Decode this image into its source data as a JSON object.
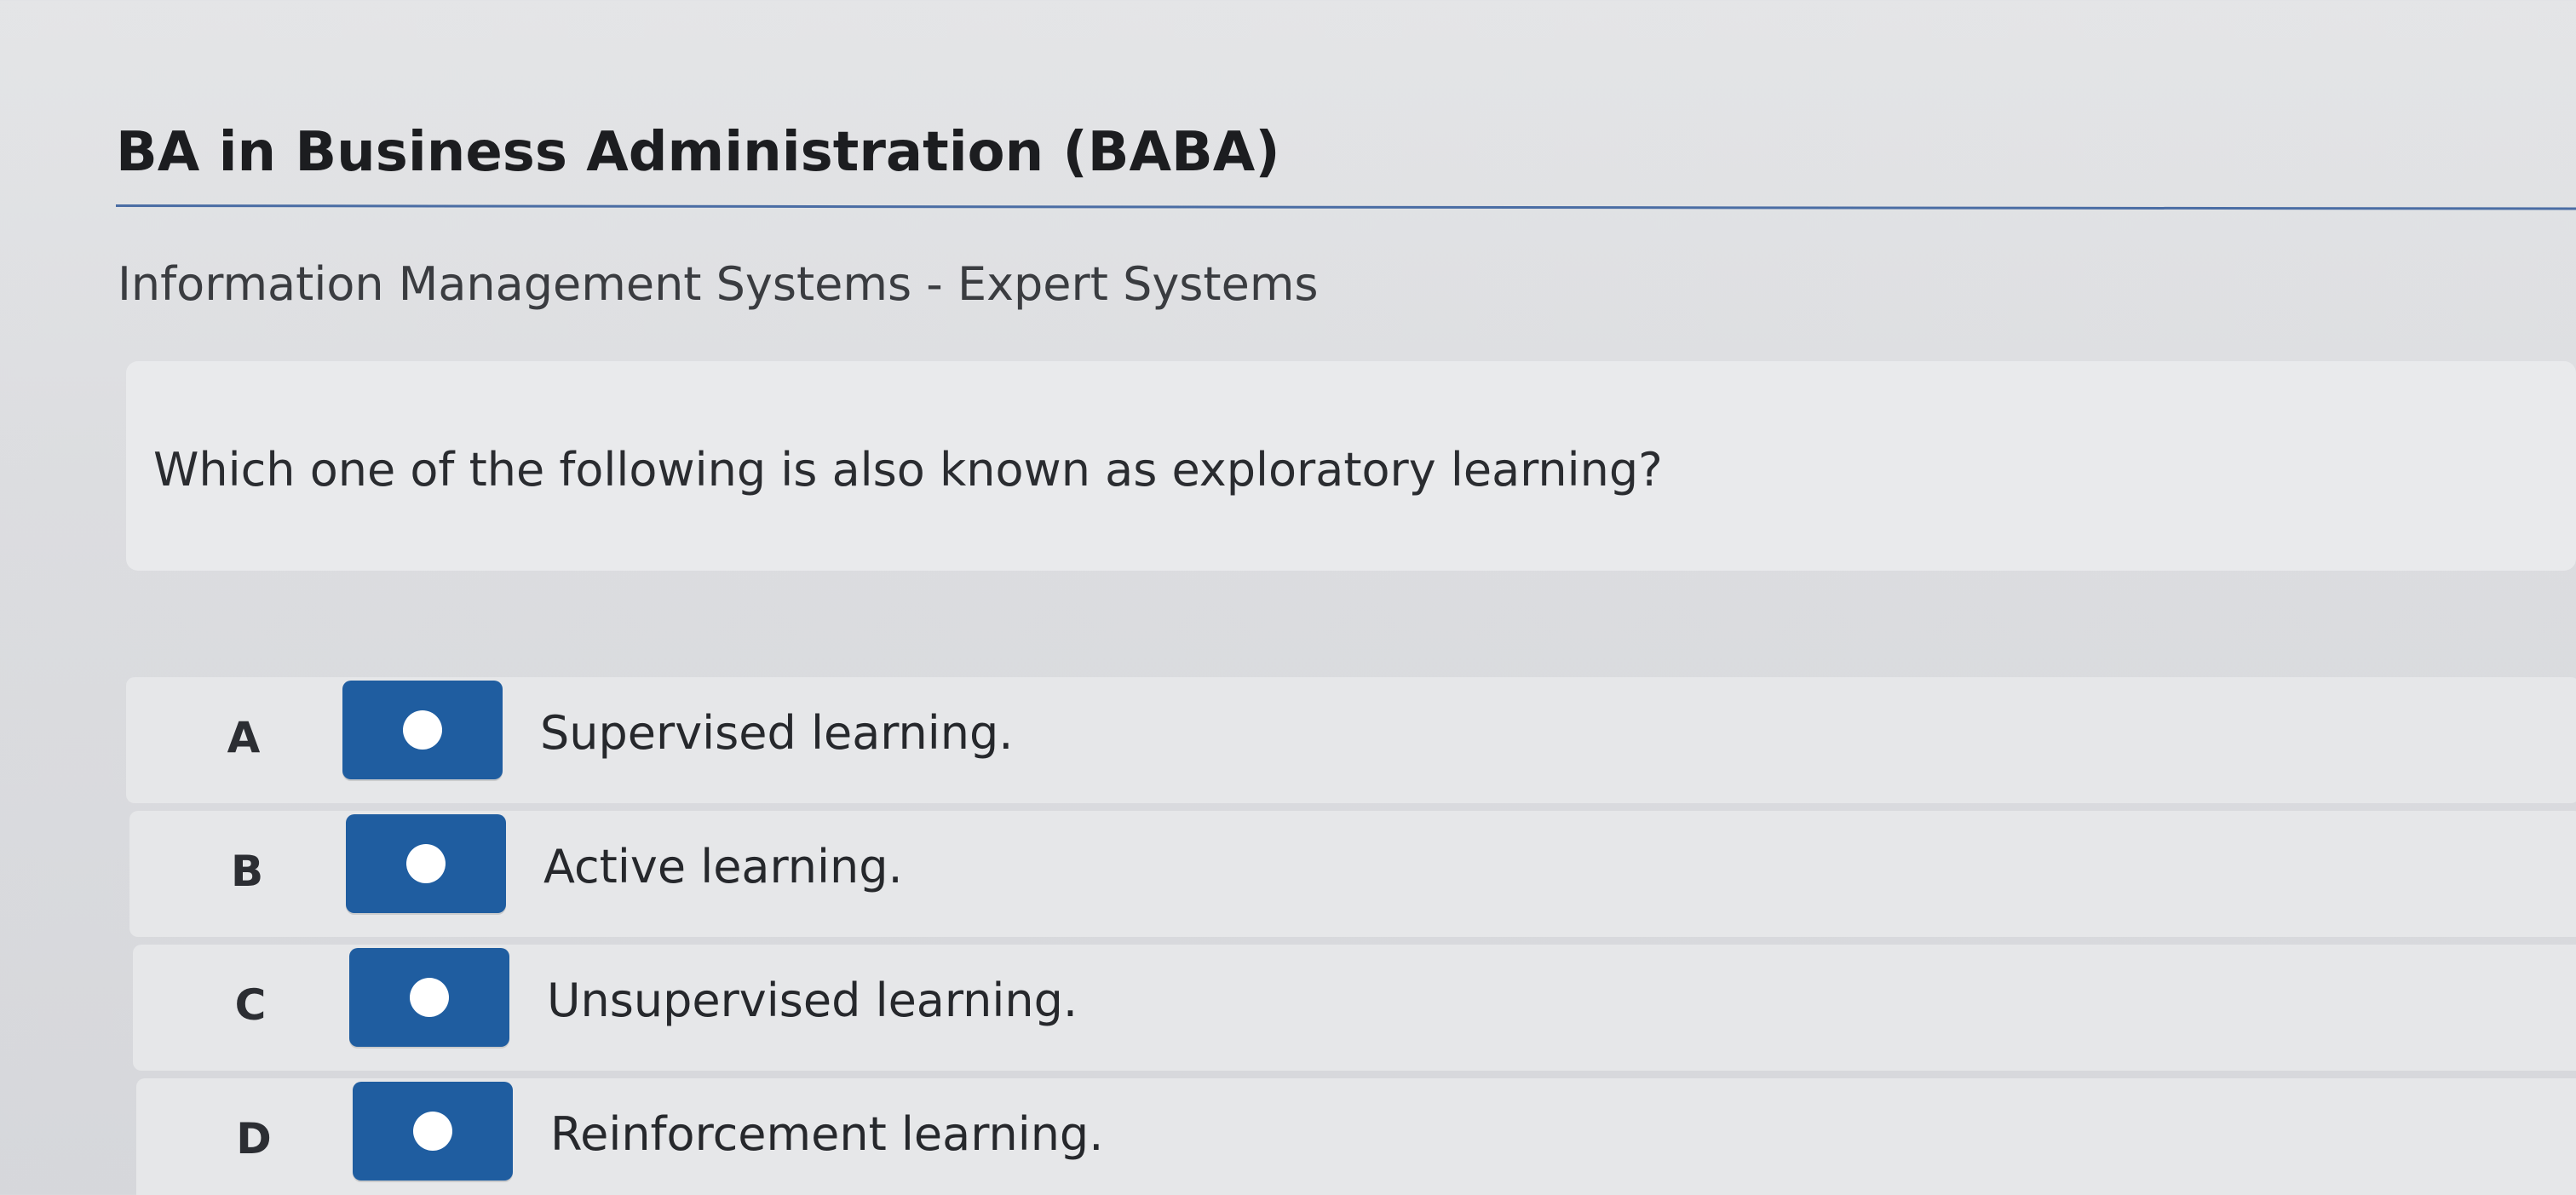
{
  "header": {
    "program_title": "BA in Business Administration (BABA)",
    "course_subtitle": "Information Management Systems - Expert Systems"
  },
  "question": {
    "text": "Which one of the following is also known as exploratory learning?"
  },
  "options": [
    {
      "letter": "A",
      "text": "Supervised learning."
    },
    {
      "letter": "B",
      "text": "Active learning."
    },
    {
      "letter": "C",
      "text": "Unsupervised learning."
    },
    {
      "letter": "D",
      "text": "Reinforcement learning."
    }
  ],
  "colors": {
    "radio_button": "#1f5da0",
    "title_rule": "#4a6da4",
    "panel": "#e6e7e9"
  }
}
